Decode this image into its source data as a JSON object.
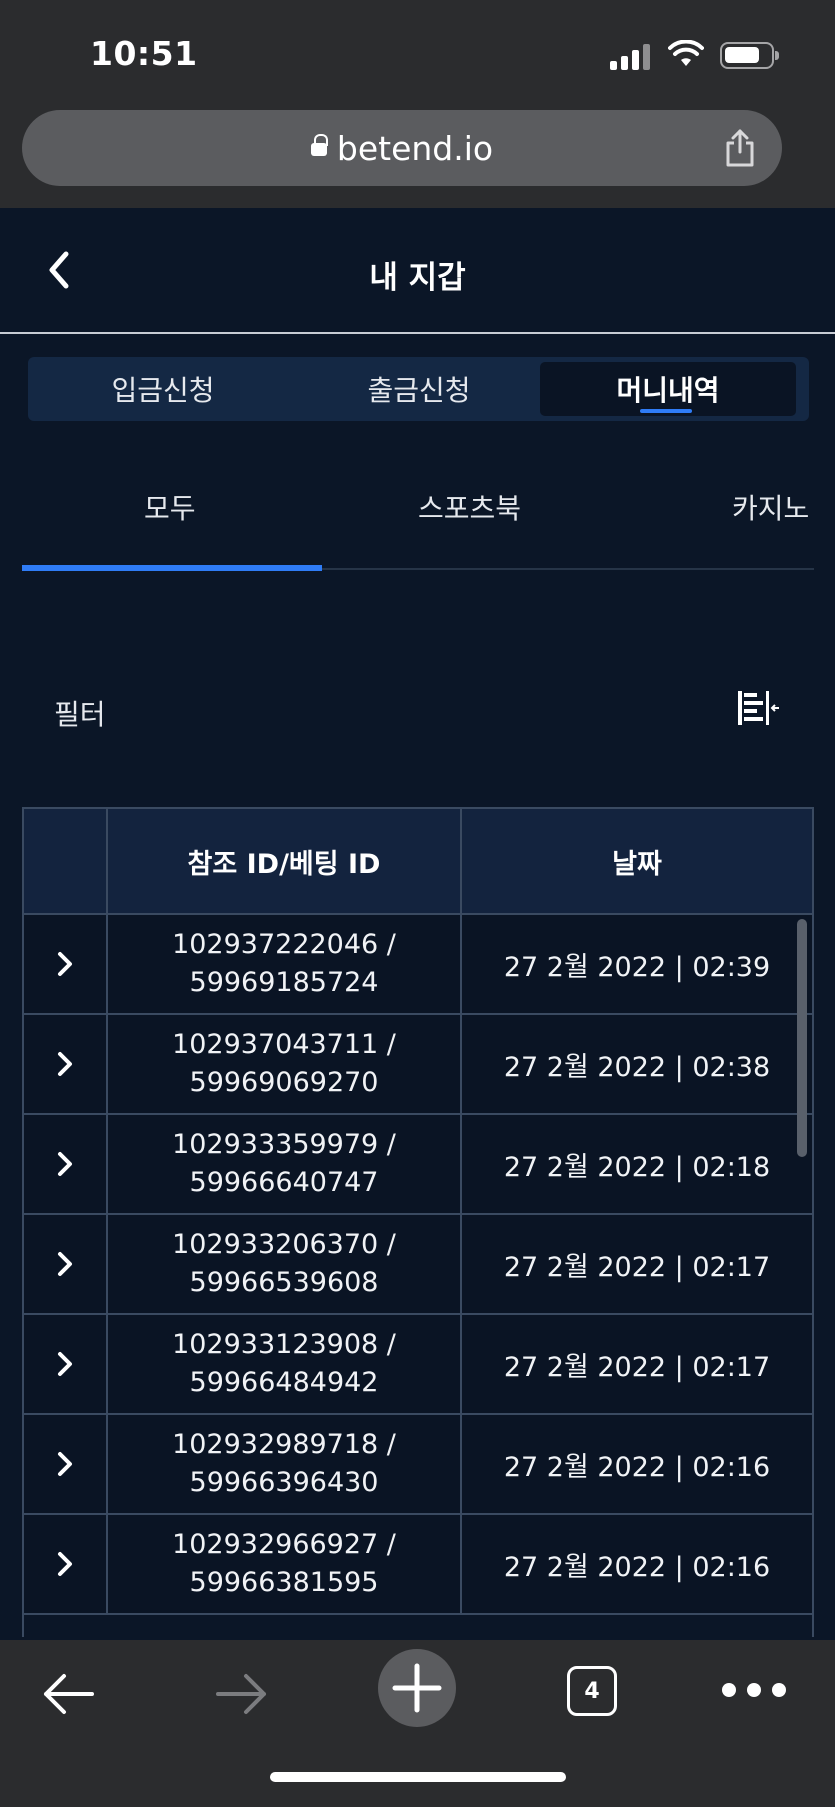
{
  "status_bar": {
    "time": "10:51"
  },
  "browser": {
    "url": "betend.io",
    "tab_count": "4"
  },
  "header": {
    "title": "내 지갑"
  },
  "segments": [
    "입금신청",
    "출금신청",
    "머니내역"
  ],
  "active_segment": "머니내역",
  "subtabs": [
    "모두",
    "스포츠북",
    "카지노"
  ],
  "active_subtab": "모두",
  "filter": {
    "label": "필터"
  },
  "table": {
    "columns": [
      "",
      "참조 ID/베팅 ID",
      "날짜"
    ],
    "rows": [
      {
        "ref_id": "102937222046 /",
        "bet_id": "59969185724",
        "date": "27 2월 2022 | 02:39"
      },
      {
        "ref_id": "102937043711 /",
        "bet_id": "59969069270",
        "date": "27 2월 2022 | 02:38"
      },
      {
        "ref_id": "102933359979 /",
        "bet_id": "59966640747",
        "date": "27 2월 2022 | 02:18"
      },
      {
        "ref_id": "102933206370 /",
        "bet_id": "59966539608",
        "date": "27 2월 2022 | 02:17"
      },
      {
        "ref_id": "102933123908 /",
        "bet_id": "59966484942",
        "date": "27 2월 2022 | 02:17"
      },
      {
        "ref_id": "102932989718 /",
        "bet_id": "59966396430",
        "date": "27 2월 2022 | 02:16"
      },
      {
        "ref_id": "102932966927 /",
        "bet_id": "59966381595",
        "date": "27 2월 2022 | 02:16"
      }
    ]
  },
  "colors": {
    "background": "#0b1627",
    "accent": "#2f7cf6",
    "header_bg": "#13233e",
    "browser_chrome": "#2b2c2e"
  }
}
